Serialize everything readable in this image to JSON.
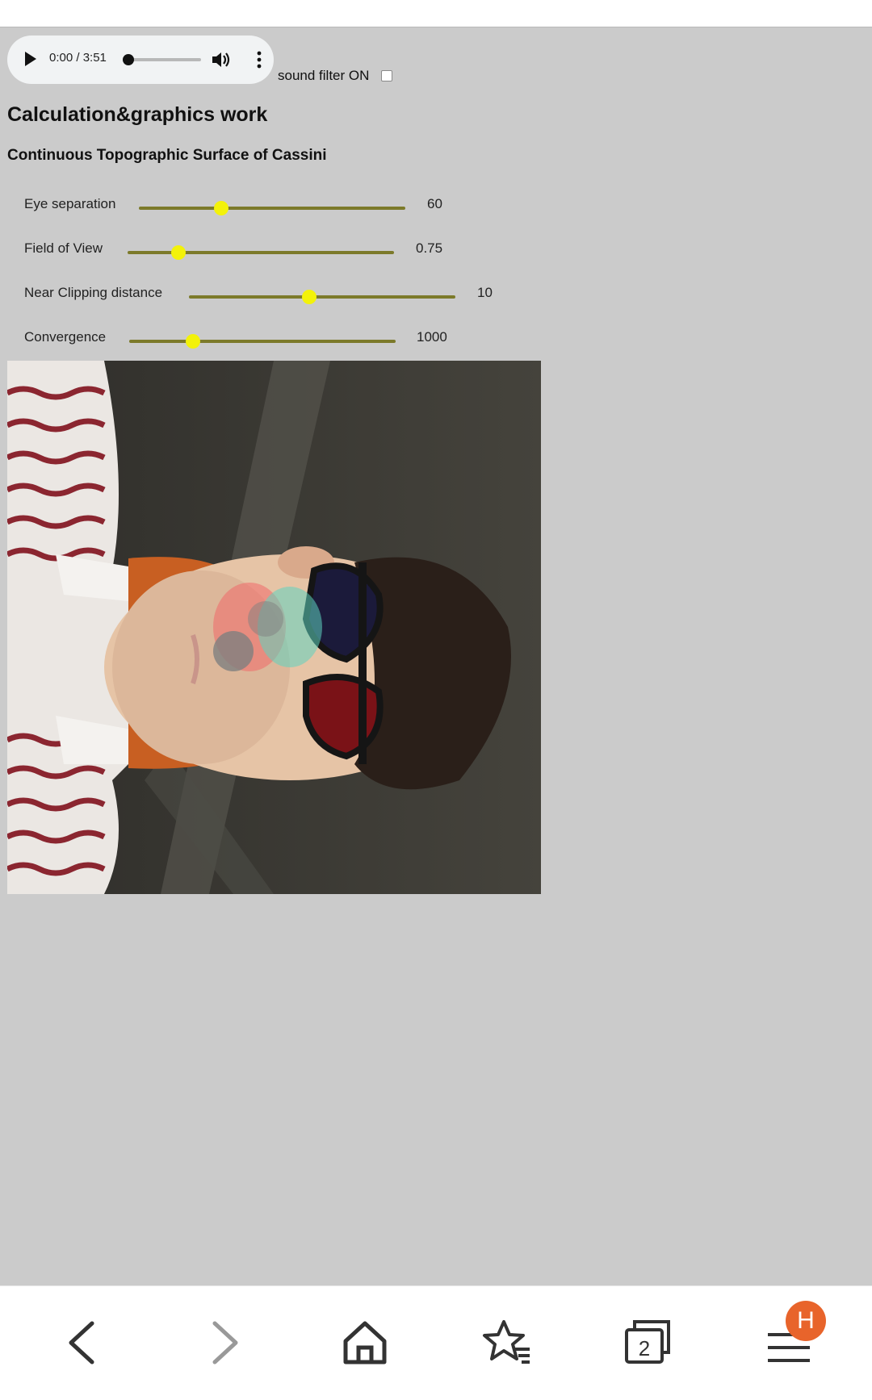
{
  "audio": {
    "time": "0:00 / 3:51",
    "progress_fraction": 0.0
  },
  "sound_filter": {
    "label": "sound filter ON",
    "checked": false
  },
  "title": "Calculation&graphics work",
  "subtitle": "Continuous Topographic Surface of Cassini",
  "controls": [
    {
      "label": "Eye separation",
      "value": "60"
    },
    {
      "label": "Field of View",
      "value": "0.75"
    },
    {
      "label": "Near Clipping distance",
      "value": "10"
    },
    {
      "label": "Convergence",
      "value": "1000"
    }
  ],
  "slider_levels": [
    0.31,
    0.19,
    0.45,
    0.24
  ],
  "colors": {
    "page_background": "#cbcbcb",
    "slider_track": "#7c7a2a",
    "slider_thumb": "#f3f20a",
    "profile_badge": "#e8642b"
  },
  "bottom_nav": {
    "tabs_count": "2",
    "profile_initial": "H",
    "icons": [
      "back-icon",
      "forward-icon",
      "home-icon",
      "bookmarks-icon",
      "tabs-icon",
      "menu-icon"
    ]
  }
}
